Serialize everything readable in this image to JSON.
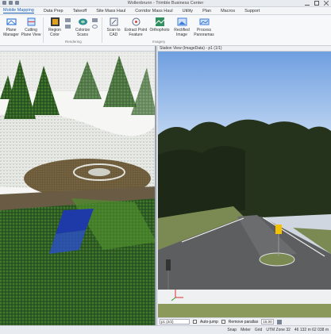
{
  "window": {
    "title": "Wollenbrunn - Trimble Business Center"
  },
  "menu": {
    "items": [
      "Mobile Mapping",
      "Data Prep",
      "Takeoff",
      "Site Mass Haul",
      "Corridor Mass Haul",
      "Utility",
      "Plan",
      "Macros",
      "Support"
    ],
    "active_index": 0
  },
  "ribbon": {
    "buttons": [
      {
        "label": "Plane\nManager",
        "icon": "plane-manager-icon",
        "color": "#3b7dd8"
      },
      {
        "label": "Cutting\nPlane View",
        "icon": "cutting-plane-icon",
        "color": "#3b7dd8"
      },
      {
        "label": "Region\nColor",
        "icon": "region-color-icon",
        "color": "#e0a020"
      },
      {
        "label": "Colorize\nScans",
        "icon": "colorize-scans-icon",
        "color": "#30a050"
      },
      {
        "label": "Scan to\nCAD",
        "icon": "scan-to-cad-icon",
        "color": "#5a6a80"
      },
      {
        "label": "Extract Point\nFeature",
        "icon": "extract-point-icon",
        "color": "#5a6a80"
      },
      {
        "label": "Orthophoto",
        "icon": "orthophoto-icon",
        "color": "#2f8f5f"
      },
      {
        "label": "Rectified\nImage",
        "icon": "rectified-image-icon",
        "color": "#3b7dd8"
      },
      {
        "label": "Process\nPanoramas",
        "icon": "process-panoramas-icon",
        "color": "#3b7dd8"
      }
    ],
    "groups": [
      "Rendering",
      "Imagery"
    ]
  },
  "image_view": {
    "title": "Station View (ImageData) - p1 (1/1)",
    "toolbar": {
      "station_select": "p1 (2/2)",
      "auto_jump_label": "Auto-jump",
      "remove_parallax_label": "Remove parallax",
      "field_value": "15.00"
    }
  },
  "status": {
    "snap_label": "Snap",
    "units": "Meter",
    "grid": "Grid",
    "zone": "UTM Zone 32",
    "coords": "46 132 m 62 038 m"
  },
  "colors": {
    "sky": "#8fb6e8",
    "trees": "#26331c",
    "road": "#5c5e60",
    "grass": "#7a8a52",
    "points_green": "#3e7a2a",
    "points_white": "#e6e8e2"
  }
}
